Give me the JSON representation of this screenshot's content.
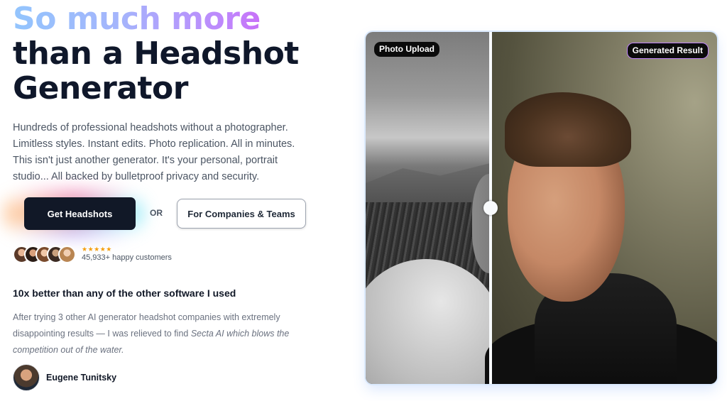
{
  "hero": {
    "title_line1": "So much more",
    "title_line2": "than a Headshot",
    "title_line3": "Generator",
    "description": "Hundreds of professional headshots without a photographer. Limitless styles. Instant edits. Photo replication. All in minutes. This isn't just another generator. It's your personal, portrait studio... All backed by bulletproof privacy and security."
  },
  "cta": {
    "primary_label": "Get Headshots",
    "or_label": "OR",
    "secondary_label": "For Companies & Teams"
  },
  "social_proof": {
    "stars": "★★★★★",
    "rating": 5,
    "customers": "45,933+ happy customers"
  },
  "review": {
    "title": "10x better than any of the other software I used",
    "body_plain": "After trying 3 other AI generator headshot companies with extremely disappointing results — I was relieved to find ",
    "body_italic": "Secta AI which blows the competition out of the water.",
    "author": "Eugene Tunitsky"
  },
  "comparison": {
    "left_badge": "Photo Upload",
    "right_badge": "Generated Result"
  },
  "colors": {
    "primary_button": "#111827",
    "gradient_start": "#93c5fd",
    "gradient_end": "#d946ef",
    "right_badge_border": "#c084fc"
  }
}
